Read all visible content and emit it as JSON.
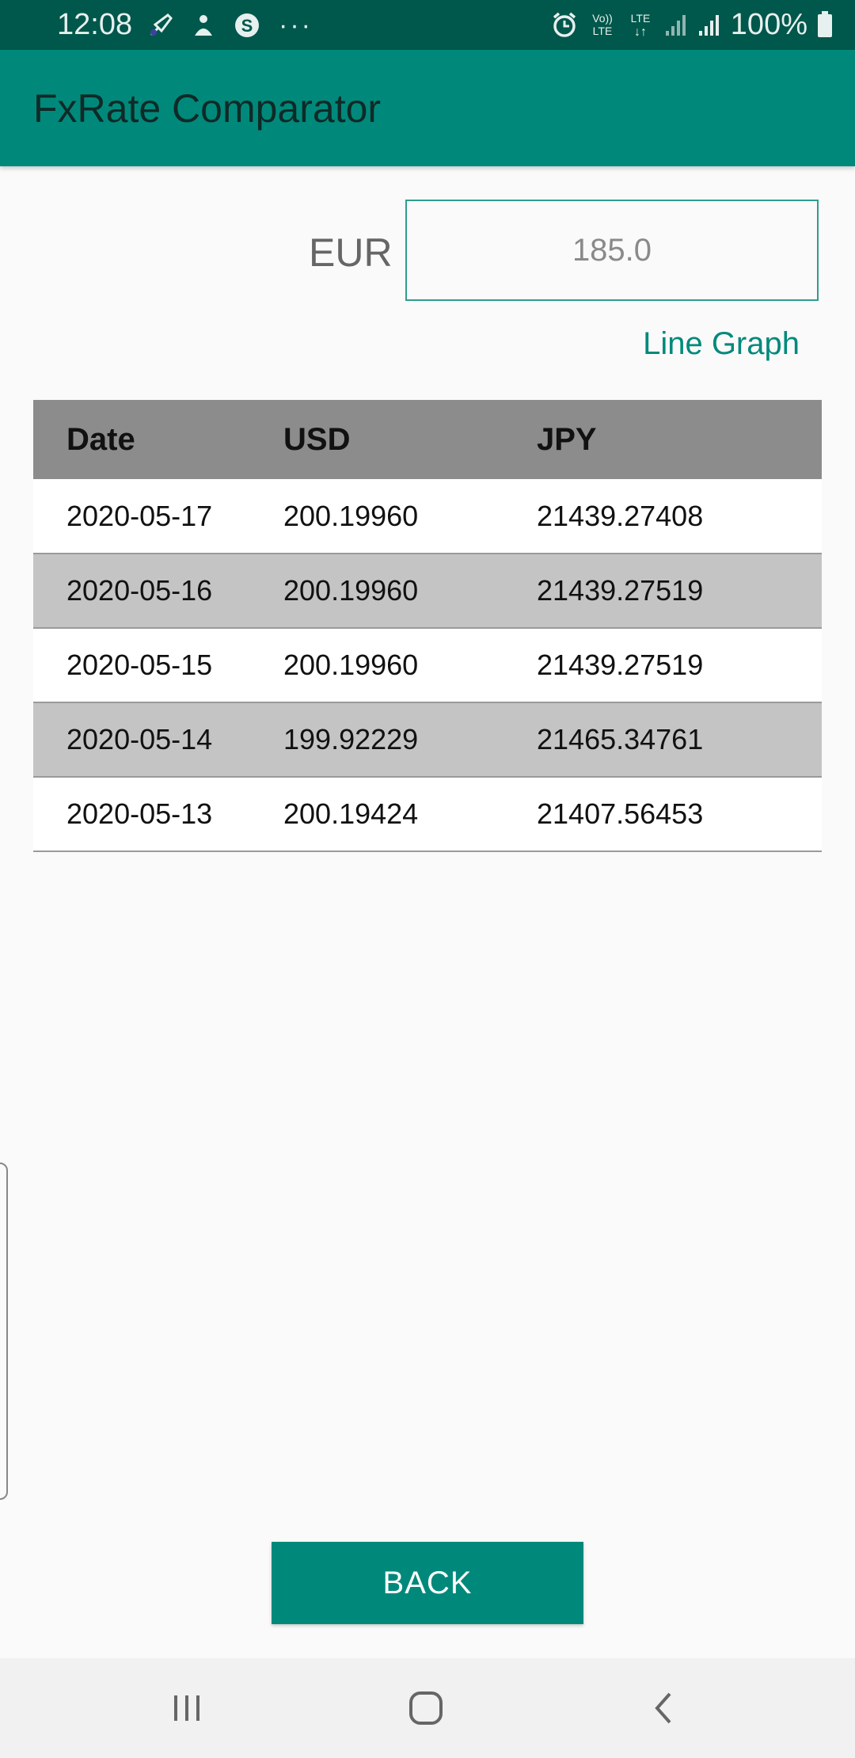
{
  "status_bar": {
    "time": "12:08",
    "battery": "100%",
    "left_icons": [
      "cursor-icon",
      "notification-icon",
      "skype-icon",
      "more-dots-icon"
    ],
    "right_icons": [
      "alarm-icon",
      "volte-icon",
      "lte-icon",
      "signal-icon",
      "signal-icon",
      "battery-icon"
    ]
  },
  "app_bar": {
    "title": "FxRate Comparator"
  },
  "converter": {
    "base_currency": "EUR",
    "amount_value": "185.0",
    "line_graph_label": "Line Graph"
  },
  "table": {
    "headers": [
      "Date",
      "USD",
      "JPY"
    ],
    "rows": [
      [
        "2020-05-17",
        "200.19960",
        "21439.27408"
      ],
      [
        "2020-05-16",
        "200.19960",
        "21439.27519"
      ],
      [
        "2020-05-15",
        "200.19960",
        "21439.27519"
      ],
      [
        "2020-05-14",
        "199.92229",
        "21465.34761"
      ],
      [
        "2020-05-13",
        "200.19424",
        "21407.56453"
      ]
    ]
  },
  "back_button": {
    "label": "BACK"
  },
  "colors": {
    "status_bar": "#00574b",
    "app_bar": "#00897b",
    "accent": "#00897b",
    "table_header": "#8c8c8c",
    "row_alt": "#c4c4c4"
  }
}
